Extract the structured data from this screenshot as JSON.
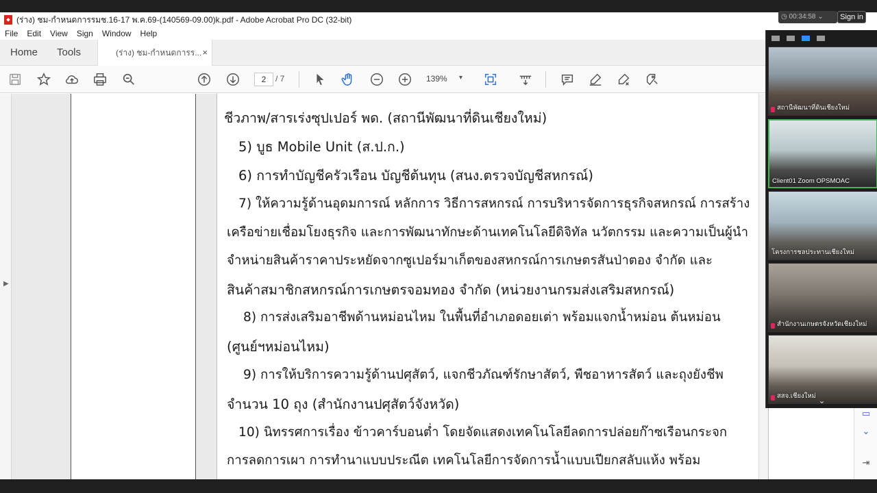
{
  "window": {
    "title": "(ร่าง) ชม-กำหนดการรมช.16-17 พ.ค.69-(140569-09.00)k.pdf - Adobe Acrobat Pro DC (32-bit)"
  },
  "menu": [
    "File",
    "Edit",
    "View",
    "Sign",
    "Window",
    "Help"
  ],
  "tabs": {
    "home": "Home",
    "tools": "Tools",
    "document": "(ร่าง) ชม-กำหนดการร...",
    "close": "×"
  },
  "toolbar": {
    "page_current": "2",
    "page_total": "/ 7",
    "zoom": "139%",
    "zoom_caret": "▾"
  },
  "document": {
    "lines": [
      "ชีวภาพ/สารเร่งซุปเปอร์ พด. (สถานีพัฒนาที่ดินเชียงใหม่)",
      "5) บูธ Mobile Unit (ส.ป.ก.)",
      "6) การทำบัญชีครัวเรือน บัญชีต้นทุน (สนง.ตรวจบัญชีสหกรณ์)",
      "7) ให้ความรู้ด้านอุดมการณ์ หลักการ วิธีการสหกรณ์ การบริหารจัดการธุรกิจสหกรณ์ การสร้าง",
      "เครือข่ายเชื่อมโยงธุรกิจ และการพัฒนาทักษะด้านเทคโนโลยีดิจิทัล นวัตกรรม และความเป็นผู้นำ",
      "จำหน่ายสินค้าราคาประหยัดจากซูเปอร์มาเก็ตของสหกรณ์การเกษตรสันป่าตอง จำกัด และ",
      "สินค้าสมาชิกสหกรณ์การเกษตรจอมทอง จำกัด (หน่วยงานกรมส่งเสริมสหกรณ์)",
      "8) การส่งเสริมอาชีพด้านหม่อนไหม ในพื้นที่อำเภอดอยเต่า พร้อมแจกน้ำหม่อน ต้นหม่อน",
      "(ศูนย์ฯหม่อนไหม)",
      "9) การให้บริการความรู้ด้านปศุสัตว์, แจกชีวภัณฑ์รักษาสัตว์, พืชอาหารสัตว์ และถุงยังชีพ",
      "จำนวน 10 ถุง (สำนักงานปศุสัตว์จังหวัด)",
      "10) นิทรรศการเรื่อง ข้าวคาร์บอนต่ำ โดยจัดแสดงเทคโนโลยีลดการปล่อยก๊าซเรือนกระจก",
      "การลดการเผา การทำนาแบบประณีต เทคโนโลยีการจัดการน้ำแบบเปียกสลับแห้ง พร้อม"
    ]
  },
  "zoom": {
    "timer": "00:34:58",
    "sign_in": "Sign in",
    "participants": [
      "สถานีพัฒนาที่ดินเชียงใหม่",
      "Client01 Zoom OPSMOAC",
      "โครงการชลประทานเชียงใหม่",
      "สำนักงานเกษตรจังหวัดเชียงใหม่",
      "สสจ.เชียงใหม่"
    ],
    "more": "⌄"
  }
}
